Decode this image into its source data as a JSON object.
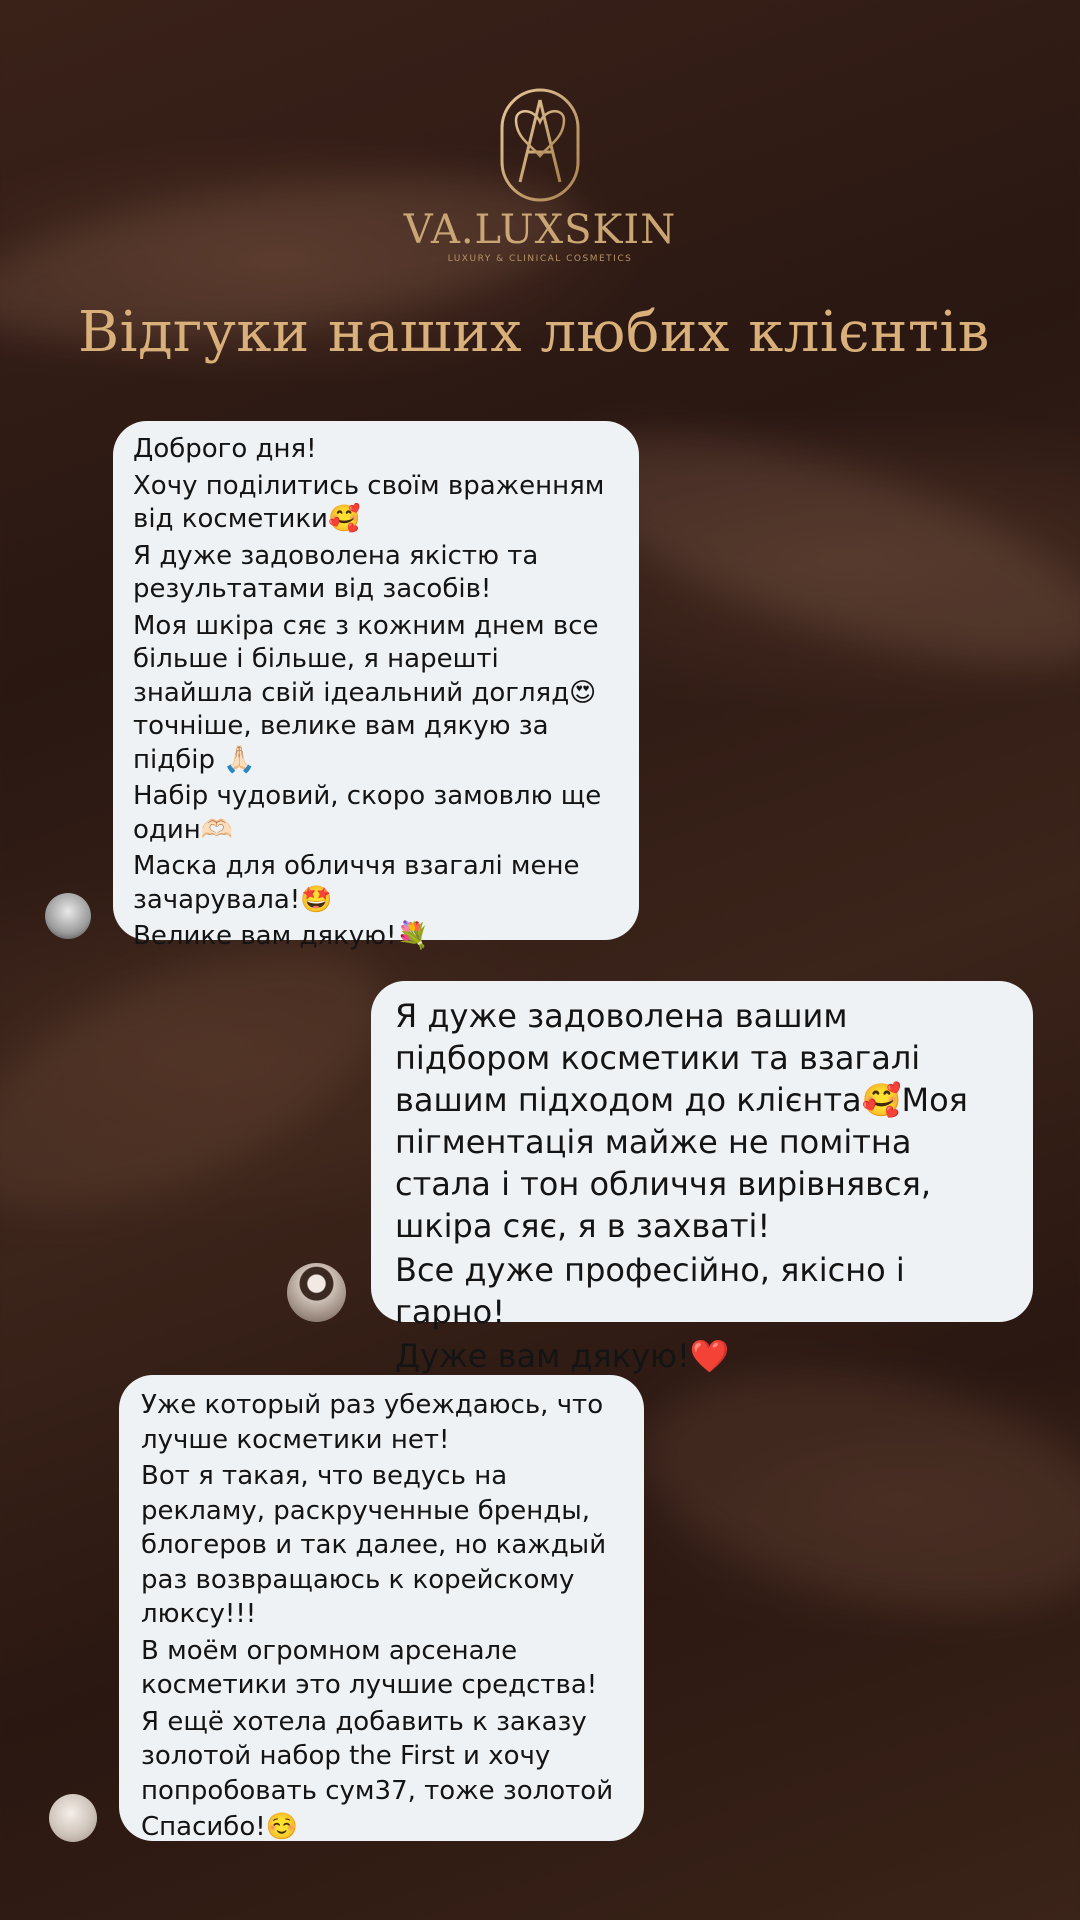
{
  "brand": {
    "name": "VA.LUXSKIN",
    "tagline": "LUXURY & CLINICAL COSMETICS"
  },
  "page_title": "Відгуки наших любих клієнтів",
  "reviews": [
    {
      "lines": [
        "Доброго дня!",
        "Хочу поділитись своїм враженням від косметики🥰",
        "Я дуже задоволена якістю та результатами від засобів!",
        "Моя шкіра сяє з кожним днем все більше і більше, я нарешті знайшла свій ідеальний догляд😍точніше, велике вам дякую за підбір 🙏🏻",
        "Набір чудовий, скоро замовлю ще один🫶🏻",
        "Маска для обличчя взагалі мене зачарувала!🤩",
        "Велике вам дякую!💐"
      ]
    },
    {
      "lines": [
        "Я дуже задоволена вашим підбором косметики та взагалі вашим підходом до клієнта🥰Моя пігментація майже не помітна стала і тон обличчя вирівнявся, шкіра сяє, я в захваті!",
        "Все дуже професійно, якісно і гарно!",
        "Дуже вам дякую!❤️"
      ]
    },
    {
      "lines": [
        "Уже который раз убеждаюсь, что лучше косметики нет!",
        "Вот я такая, что ведусь на рекламу, раскрученные бренды, блогеров и так далее, но каждый раз возвращаюсь к корейскому люксу!!!",
        "В моём огромном арсенале косметики это лучшие средства!",
        "Я ещё хотела добавить к заказу золотой набор the First и хочу попробовать сум37, тоже золотой",
        "Спасибо!☺️"
      ]
    }
  ]
}
